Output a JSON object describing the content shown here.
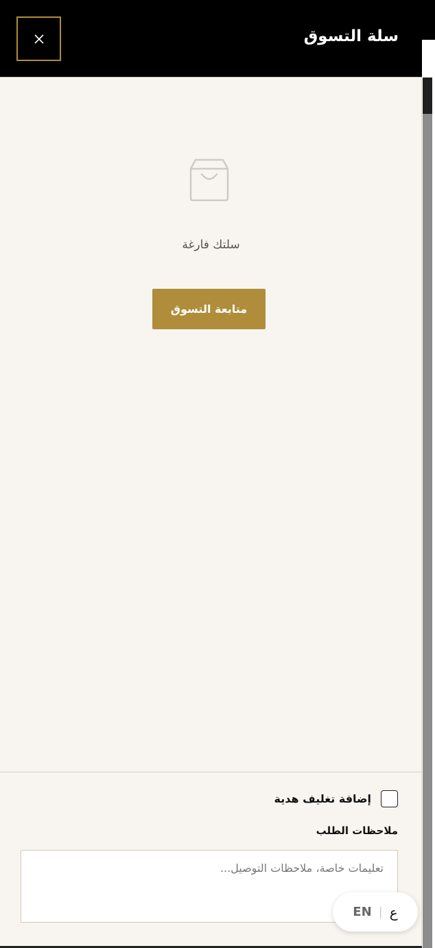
{
  "header": {
    "title": "سلة التسوق",
    "close_label": "×"
  },
  "empty_state": {
    "icon": "shopping-bag-icon",
    "message": "سلتك فارغة",
    "continue_label": "متابعة التسوق"
  },
  "footer": {
    "gift_wrap_label": "إضافة تغليف هدية",
    "gift_wrap_checked": false,
    "notes_label": "ملاحظات الطلب",
    "notes_placeholder": "تعليمات خاصة، ملاحظات التوصيل...",
    "notes_value": ""
  },
  "language": {
    "en_label": "EN",
    "ar_label": "ع"
  },
  "colors": {
    "accent": "#b08d3a",
    "header_bg": "#000000",
    "drawer_bg": "#f8f5f0"
  }
}
